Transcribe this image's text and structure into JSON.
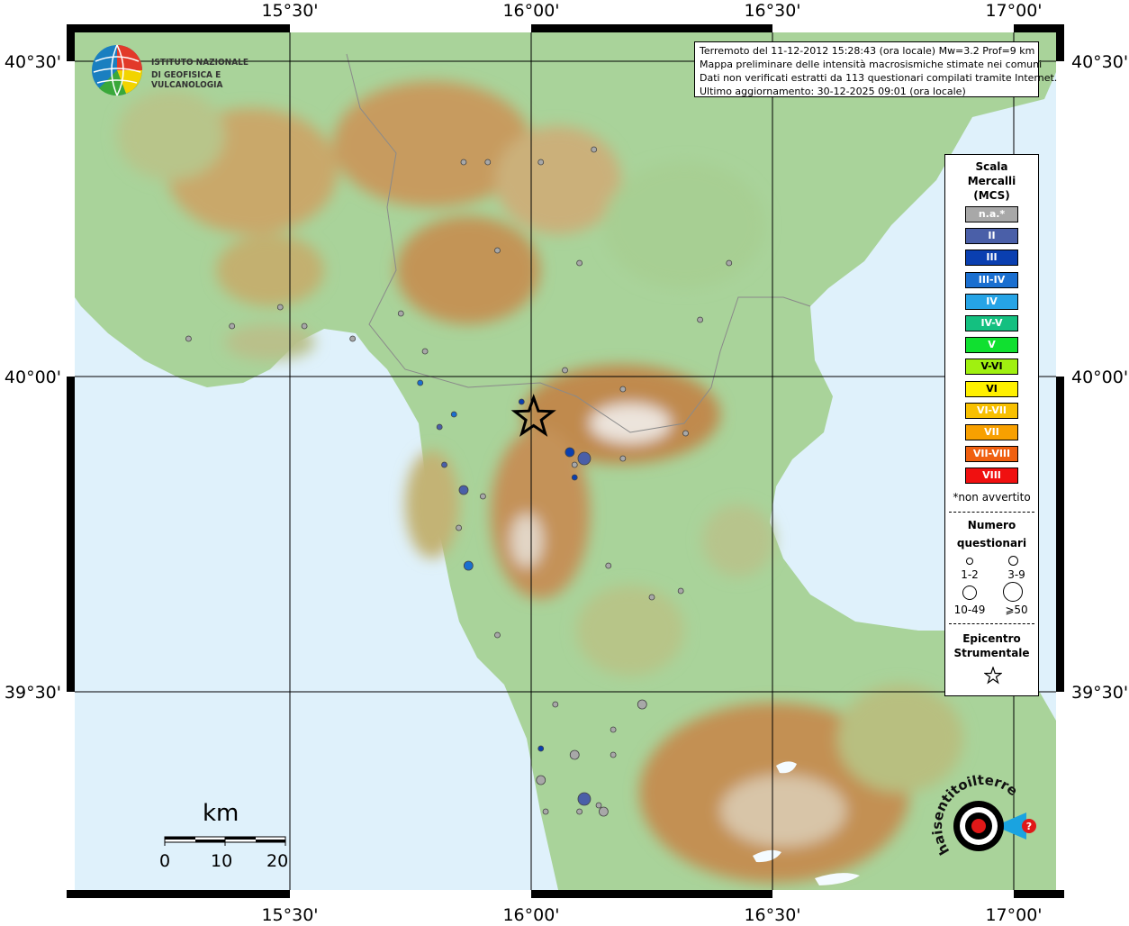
{
  "header": {
    "lines": [
      "Terremoto del 11-12-2012 15:28:43 (ora locale) Mw=3.2 Prof=9 km",
      "Mappa preliminare delle intensità macrosismiche stimate nei comuni",
      "Dati non verificati estratti da 113 questionari compilati tramite Internet.",
      "Ultimo aggiornamento: 30-12-2025 09:01 (ora locale)"
    ]
  },
  "map": {
    "lon_ticks": [
      "15°30'",
      "16°00'",
      "16°30'",
      "17°00'"
    ],
    "lat_ticks": [
      "40°30'",
      "40°00'",
      "39°30'"
    ],
    "colors": {
      "sea": "#dff1fb",
      "low": "#9fcf8e",
      "mid": "#c7b46a",
      "high": "#b98a4a",
      "peak": "#e8e2dc"
    }
  },
  "logos": {
    "ingv_line1": "ISTITUTO NAZIONALE",
    "ingv_line2": "DI GEOFISICA E VULCANOLOGIA",
    "hst_text": "haisentitoilterremoto.it",
    "hst_url": "www."
  },
  "legend": {
    "title": [
      "Scala",
      "Mercalli",
      "(MCS)"
    ],
    "classes": [
      {
        "label": "n.a.*",
        "color": "#a8a8a8"
      },
      {
        "label": "II",
        "color": "#4a5fa8"
      },
      {
        "label": "III",
        "color": "#0a3fb0"
      },
      {
        "label": "III-IV",
        "color": "#1a6fd0"
      },
      {
        "label": "IV",
        "color": "#26a4e6"
      },
      {
        "label": "IV-V",
        "color": "#14c080"
      },
      {
        "label": "V",
        "color": "#10e030"
      },
      {
        "label": "V-VI",
        "color": "#a0f010"
      },
      {
        "label": "VI",
        "color": "#fff000"
      },
      {
        "label": "VI-VII",
        "color": "#f8c000"
      },
      {
        "label": "VII",
        "color": "#f8a000"
      },
      {
        "label": "VII-VIII",
        "color": "#f06010"
      },
      {
        "label": "VIII",
        "color": "#f01010"
      }
    ],
    "note": "*non avvertito",
    "count_title": [
      "Numero",
      "questionari"
    ],
    "count_classes": [
      "1-2",
      "3-9",
      "10-49",
      "⩾50"
    ],
    "epicenter_title": [
      "Epicentro",
      "Strumentale"
    ]
  },
  "scalebar": {
    "unit": "km",
    "labels": [
      "0",
      "10",
      "20"
    ]
  },
  "points": [
    {
      "lon": 15.86,
      "lat": 40.34,
      "c": 0,
      "s": 1
    },
    {
      "lon": 15.91,
      "lat": 40.34,
      "c": 0,
      "s": 1
    },
    {
      "lon": 16.02,
      "lat": 40.34,
      "c": 0,
      "s": 1
    },
    {
      "lon": 16.13,
      "lat": 40.36,
      "c": 0,
      "s": 1
    },
    {
      "lon": 15.93,
      "lat": 40.2,
      "c": 0,
      "s": 1
    },
    {
      "lon": 16.1,
      "lat": 40.18,
      "c": 0,
      "s": 1
    },
    {
      "lon": 16.41,
      "lat": 40.18,
      "c": 0,
      "s": 1
    },
    {
      "lon": 15.48,
      "lat": 40.11,
      "c": 0,
      "s": 1
    },
    {
      "lon": 15.38,
      "lat": 40.08,
      "c": 0,
      "s": 1
    },
    {
      "lon": 15.53,
      "lat": 40.08,
      "c": 0,
      "s": 1
    },
    {
      "lon": 15.29,
      "lat": 40.06,
      "c": 0,
      "s": 1
    },
    {
      "lon": 15.63,
      "lat": 40.06,
      "c": 0,
      "s": 1
    },
    {
      "lon": 15.73,
      "lat": 40.1,
      "c": 0,
      "s": 1
    },
    {
      "lon": 15.78,
      "lat": 40.04,
      "c": 0,
      "s": 1
    },
    {
      "lon": 16.35,
      "lat": 40.09,
      "c": 0,
      "s": 1
    },
    {
      "lon": 16.07,
      "lat": 40.01,
      "c": 0,
      "s": 1
    },
    {
      "lon": 15.77,
      "lat": 39.99,
      "c": 3,
      "s": 1
    },
    {
      "lon": 16.19,
      "lat": 39.98,
      "c": 0,
      "s": 1
    },
    {
      "lon": 15.98,
      "lat": 39.96,
      "c": 2,
      "s": 1
    },
    {
      "lon": 15.84,
      "lat": 39.94,
      "c": 3,
      "s": 1
    },
    {
      "lon": 15.81,
      "lat": 39.92,
      "c": 1,
      "s": 1
    },
    {
      "lon": 16.32,
      "lat": 39.91,
      "c": 0,
      "s": 1
    },
    {
      "lon": 16.08,
      "lat": 39.88,
      "c": 2,
      "s": 2
    },
    {
      "lon": 16.11,
      "lat": 39.87,
      "c": 1,
      "s": 3
    },
    {
      "lon": 16.09,
      "lat": 39.86,
      "c": 0,
      "s": 1
    },
    {
      "lon": 16.19,
      "lat": 39.87,
      "c": 0,
      "s": 1
    },
    {
      "lon": 15.82,
      "lat": 39.86,
      "c": 1,
      "s": 1
    },
    {
      "lon": 16.09,
      "lat": 39.84,
      "c": 2,
      "s": 1
    },
    {
      "lon": 15.9,
      "lat": 39.81,
      "c": 0,
      "s": 1
    },
    {
      "lon": 15.86,
      "lat": 39.82,
      "c": 1,
      "s": 2
    },
    {
      "lon": 15.85,
      "lat": 39.76,
      "c": 0,
      "s": 1
    },
    {
      "lon": 15.87,
      "lat": 39.7,
      "c": 3,
      "s": 2
    },
    {
      "lon": 16.16,
      "lat": 39.7,
      "c": 0,
      "s": 1
    },
    {
      "lon": 16.31,
      "lat": 39.66,
      "c": 0,
      "s": 1
    },
    {
      "lon": 16.25,
      "lat": 39.65,
      "c": 0,
      "s": 1
    },
    {
      "lon": 15.93,
      "lat": 39.59,
      "c": 0,
      "s": 1
    },
    {
      "lon": 16.05,
      "lat": 39.48,
      "c": 0,
      "s": 1
    },
    {
      "lon": 16.23,
      "lat": 39.48,
      "c": 0,
      "s": 2
    },
    {
      "lon": 16.17,
      "lat": 39.44,
      "c": 0,
      "s": 1
    },
    {
      "lon": 16.02,
      "lat": 39.41,
      "c": 2,
      "s": 1
    },
    {
      "lon": 16.09,
      "lat": 39.4,
      "c": 0,
      "s": 2
    },
    {
      "lon": 16.17,
      "lat": 39.4,
      "c": 0,
      "s": 1
    },
    {
      "lon": 16.02,
      "lat": 39.36,
      "c": 0,
      "s": 2
    },
    {
      "lon": 16.11,
      "lat": 39.33,
      "c": 1,
      "s": 3
    },
    {
      "lon": 16.14,
      "lat": 39.32,
      "c": 0,
      "s": 1
    },
    {
      "lon": 16.1,
      "lat": 39.31,
      "c": 0,
      "s": 1
    },
    {
      "lon": 16.03,
      "lat": 39.31,
      "c": 0,
      "s": 1
    },
    {
      "lon": 16.15,
      "lat": 39.31,
      "c": 0,
      "s": 2
    }
  ],
  "epicenter": {
    "lon": 16.005,
    "lat": 39.935
  }
}
